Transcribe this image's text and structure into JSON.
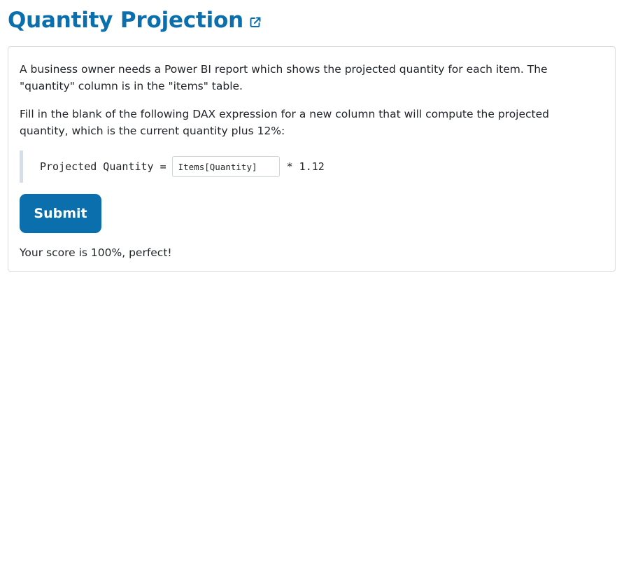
{
  "page": {
    "title": "Quantity Projection",
    "external_link_icon": "external-link-icon"
  },
  "question": {
    "paragraph_1": "A business owner needs a Power BI report which shows the projected quantity for each item. The \"quantity\" column is in the \"items\" table.",
    "paragraph_2": "Fill in the blank of the following DAX expression for a new column that will compute the projected quantity, which is the current quantity plus 12%:",
    "code_prefix": "Projected Quantity =",
    "answer_value": "Items[Quantity]",
    "code_suffix": "* 1.12"
  },
  "actions": {
    "submit_label": "Submit"
  },
  "result": {
    "score_text": "Your score is 100%, perfect!"
  },
  "colors": {
    "accent": "#0b6fad",
    "border": "#dcdcdc",
    "code_bar": "#d7dee6"
  }
}
